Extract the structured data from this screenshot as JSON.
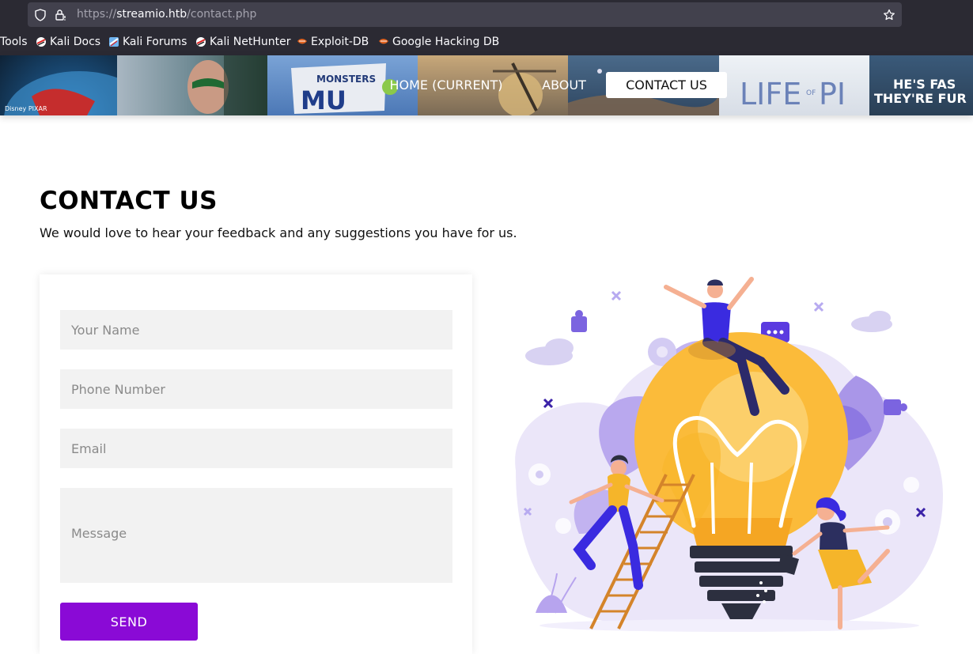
{
  "browser": {
    "url_scheme": "https://",
    "url_host": "streamio.htb",
    "url_path": "/contact.php",
    "bookmarks": [
      {
        "label": "Tools"
      },
      {
        "label": "Kali Docs"
      },
      {
        "label": "Kali Forums"
      },
      {
        "label": "Kali NetHunter"
      },
      {
        "label": "Exploit-DB"
      },
      {
        "label": "Google Hacking DB"
      }
    ]
  },
  "nav": {
    "items": [
      {
        "label": "HOME (CURRENT)"
      },
      {
        "label": "ABOUT"
      },
      {
        "label": "CONTACT US"
      }
    ],
    "banner_texts": {
      "monsters": "MONSTERS",
      "mu": "MU",
      "pixar": "Disney PIXAR",
      "life_of_pi": "LIFE",
      "of": "OF",
      "pi": "PI",
      "fast1": "HE'S FAS",
      "fast2": "THEY'RE FUR"
    }
  },
  "page": {
    "title": "CONTACT US",
    "subtitle": "We would love to hear your feedback and any suggestions you have for us."
  },
  "form": {
    "name_placeholder": "Your Name",
    "phone_placeholder": "Phone Number",
    "email_placeholder": "Email",
    "message_placeholder": "Message",
    "send_label": "SEND"
  },
  "colors": {
    "accent": "#8a0ad6",
    "chrome_bg": "#2b2a33",
    "field_bg": "#f2f2f2"
  }
}
